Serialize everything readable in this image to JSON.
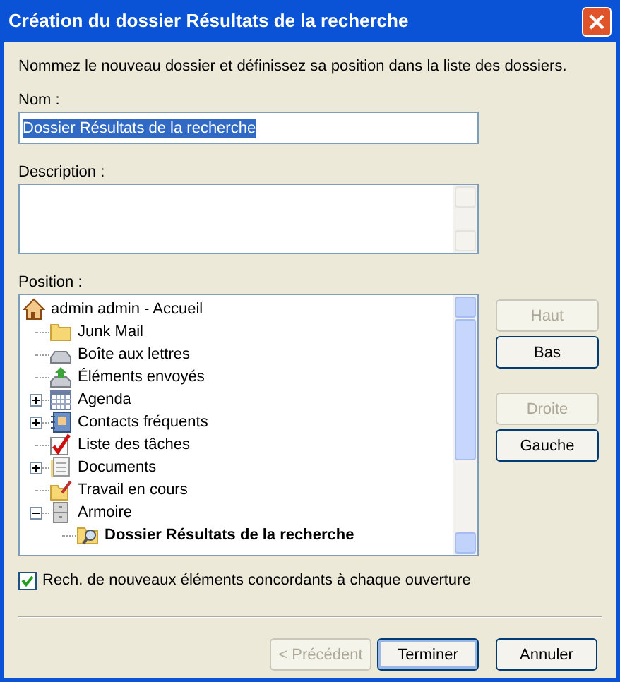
{
  "window": {
    "title": "Création du dossier Résultats de la recherche"
  },
  "intro": "Nommez le nouveau dossier et définissez sa position dans la liste des dossiers.",
  "name_field": {
    "label": "Nom :",
    "value": "Dossier Résultats de la recherche",
    "selected": true
  },
  "description_field": {
    "label": "Description :"
  },
  "position": {
    "label": "Position :",
    "tree": [
      {
        "label": "admin admin - Accueil",
        "kind": "home",
        "selected": false,
        "children": [
          {
            "label": "Junk Mail",
            "kind": "folder",
            "selected": false
          },
          {
            "label": "Boîte aux lettres",
            "kind": "inbox",
            "selected": false
          },
          {
            "label": "Éléments envoyés",
            "kind": "sent",
            "selected": false
          },
          {
            "label": "Agenda",
            "kind": "calendar",
            "expanded": false,
            "selected": false
          },
          {
            "label": "Contacts fréquents",
            "kind": "contacts",
            "expanded": false,
            "selected": false
          },
          {
            "label": "Liste des tâches",
            "kind": "tasks",
            "selected": false
          },
          {
            "label": "Documents",
            "kind": "documents",
            "expanded": false,
            "selected": false
          },
          {
            "label": "Travail en cours",
            "kind": "work",
            "selected": false
          },
          {
            "label": "Armoire",
            "kind": "cabinet",
            "expanded": true,
            "selected": false,
            "children": [
              {
                "label": "Dossier Résultats de la recherche",
                "kind": "search_folder",
                "selected": true
              }
            ]
          }
        ]
      }
    ]
  },
  "side_buttons": [
    {
      "label": "Haut",
      "disabled": true
    },
    {
      "label": "Bas",
      "disabled": false
    },
    {
      "label": "Droite",
      "disabled": true
    },
    {
      "label": "Gauche",
      "disabled": false
    }
  ],
  "checkbox": {
    "label": "Rech. de nouveaux éléments concordants à chaque ouverture",
    "checked": true
  },
  "footer_buttons": [
    {
      "label": "< Précédent",
      "disabled": true,
      "default": false
    },
    {
      "label": "Terminer",
      "disabled": false,
      "default": true
    },
    {
      "label": "Annuler",
      "disabled": false,
      "default": false
    }
  ]
}
